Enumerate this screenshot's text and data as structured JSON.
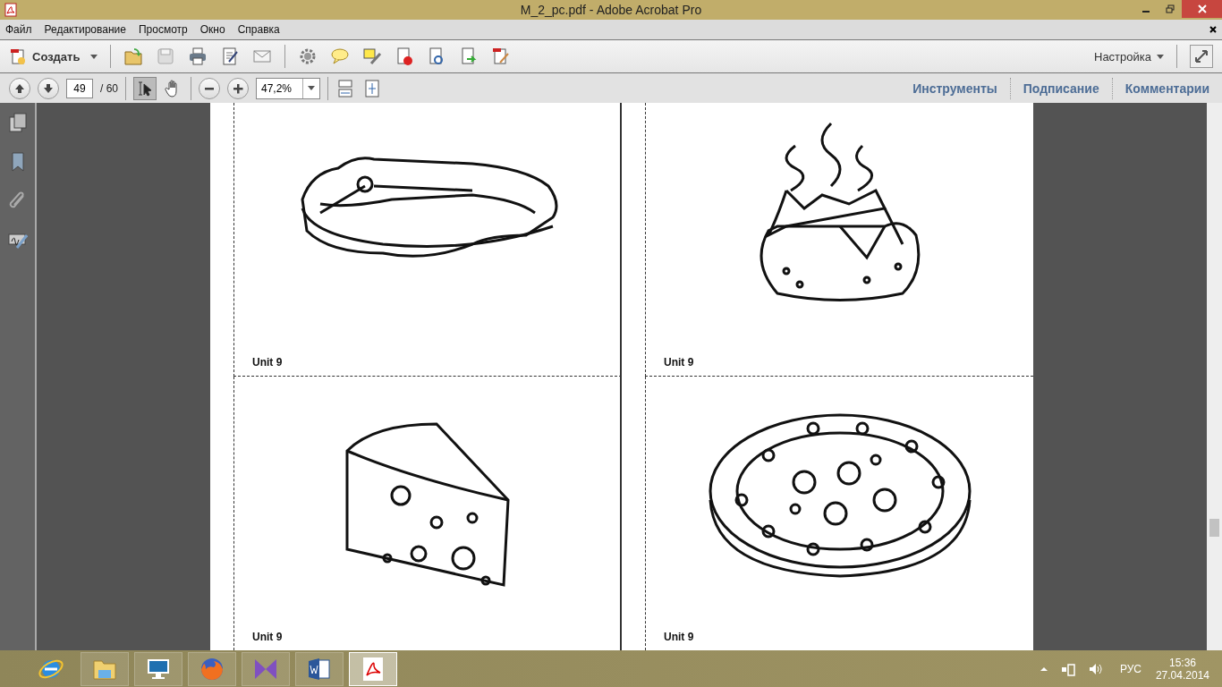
{
  "window": {
    "title": "M_2_pc.pdf - Adobe Acrobat Pro"
  },
  "menu": [
    "Файл",
    "Редактирование",
    "Просмотр",
    "Окно",
    "Справка"
  ],
  "toolbar": {
    "create": "Создать",
    "customize": "Настройка"
  },
  "navigation": {
    "page": "49",
    "page_total": "/ 60",
    "zoom": "47,2%"
  },
  "panels": [
    {
      "label": "Инструменты"
    },
    {
      "label": "Подписание"
    },
    {
      "label": "Комментарии"
    }
  ],
  "cards": [
    {
      "kind": "steak",
      "label": "Unit 9"
    },
    {
      "kind": "potato",
      "label": "Unit 9"
    },
    {
      "kind": "cheese",
      "label": "Unit 9"
    },
    {
      "kind": "pizza",
      "label": "Unit 9"
    }
  ],
  "taskbar": [
    {
      "kind": "browser",
      "selected": false
    },
    {
      "kind": "folder",
      "selected": false
    },
    {
      "kind": "monitor",
      "selected": false
    },
    {
      "kind": "firefox",
      "selected": false
    },
    {
      "kind": "media",
      "selected": false
    },
    {
      "kind": "word",
      "selected": false
    },
    {
      "kind": "acrobat",
      "selected": true
    }
  ],
  "tray": {
    "language": "РУС",
    "time": "15:36",
    "date": "27.04.2014"
  }
}
